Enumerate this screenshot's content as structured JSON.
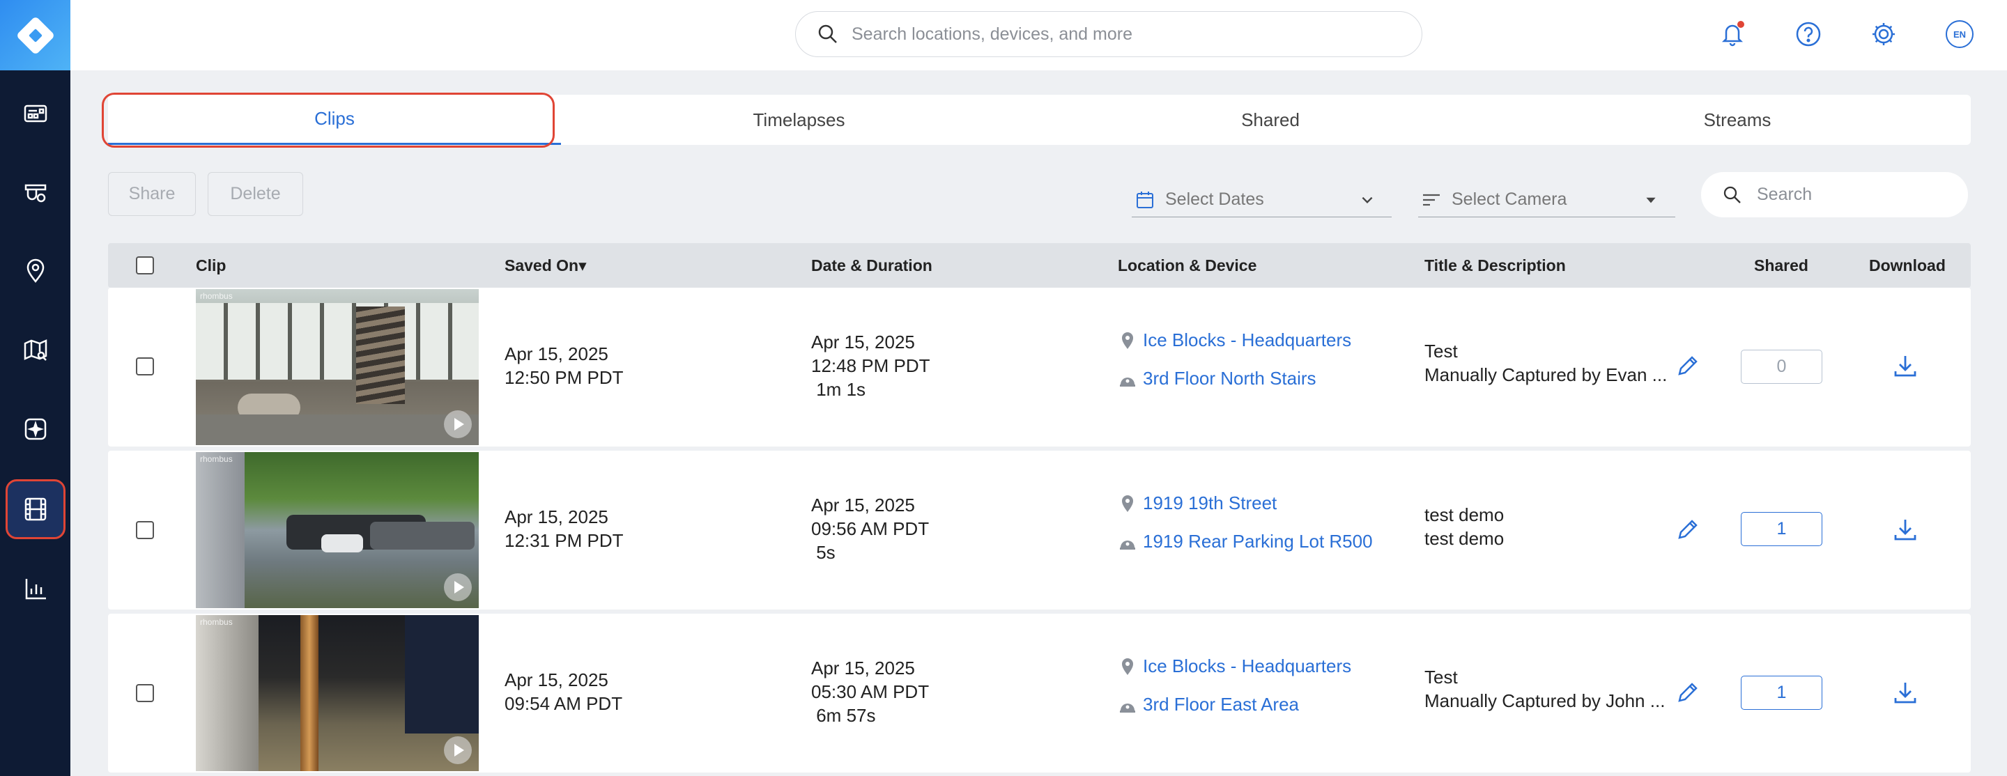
{
  "header": {
    "search_placeholder": "Search locations, devices, and more",
    "language": "EN"
  },
  "sidebar": {
    "items": [
      "dashboard-icon",
      "devices-icon",
      "locations-icon",
      "map-icon",
      "ai-icon",
      "clips-icon",
      "reports-icon"
    ],
    "active": "clips-icon"
  },
  "tabs": [
    {
      "label": "Clips",
      "active": true
    },
    {
      "label": "Timelapses",
      "active": false
    },
    {
      "label": "Shared",
      "active": false
    },
    {
      "label": "Streams",
      "active": false
    }
  ],
  "toolbar": {
    "share_label": "Share",
    "delete_label": "Delete",
    "dates_placeholder": "Select Dates",
    "camera_placeholder": "Select Camera",
    "search_placeholder": "Search"
  },
  "table": {
    "headers": {
      "clip": "Clip",
      "saved_on": "Saved On▾",
      "date_duration": "Date & Duration",
      "location_device": "Location & Device",
      "title_description": "Title & Description",
      "shared": "Shared",
      "download": "Download"
    },
    "rows": [
      {
        "saved_date": "Apr 15, 2025",
        "saved_time": "12:50 PM PDT",
        "clip_date": "Apr 15, 2025",
        "clip_time": "12:48 PM PDT",
        "duration": " 1m 1s",
        "location": "Ice Blocks - Headquarters",
        "device": "3rd Floor North Stairs",
        "title": "Test",
        "description": "Manually Captured by Evan ...",
        "shared": "0",
        "brand": "rhombus"
      },
      {
        "saved_date": "Apr 15, 2025",
        "saved_time": "12:31 PM PDT",
        "clip_date": "Apr 15, 2025",
        "clip_time": "09:56 AM PDT",
        "duration": " 5s",
        "location": "1919 19th Street",
        "device": "1919 Rear Parking Lot R500",
        "title": "test demo",
        "description": "test demo",
        "shared": "1",
        "brand": "rhombus"
      },
      {
        "saved_date": "Apr 15, 2025",
        "saved_time": "09:54 AM PDT",
        "clip_date": "Apr 15, 2025",
        "clip_time": "05:30 AM PDT",
        "duration": " 6m 57s",
        "location": "Ice Blocks - Headquarters",
        "device": "3rd Floor East Area",
        "title": "Test",
        "description": "Manually Captured by John ...",
        "shared": "1",
        "brand": "rhombus"
      }
    ]
  },
  "colors": {
    "accent": "#2a6fd6",
    "sidebar": "#0e1b34",
    "highlight": "#e04535"
  }
}
